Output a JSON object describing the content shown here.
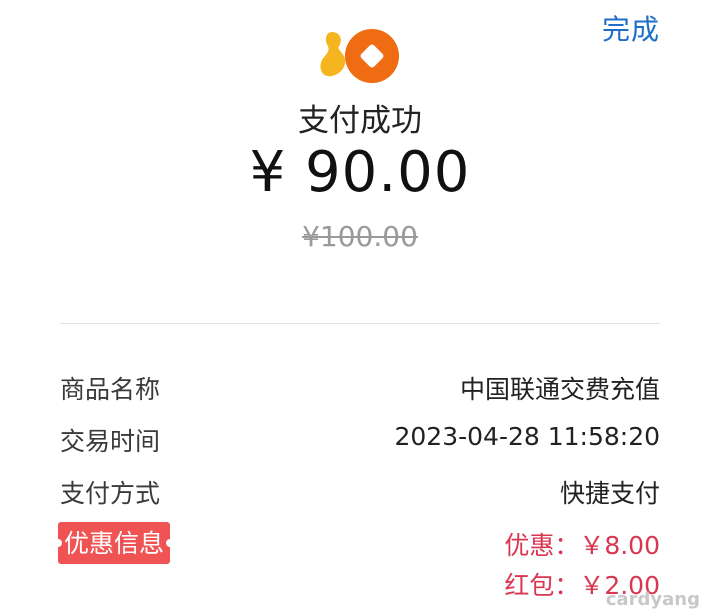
{
  "header": {
    "done_label": "完成"
  },
  "logo": {
    "icon": "pay-logo-icon",
    "colors": {
      "yellow": "#f5b51f",
      "orange": "#f06c12"
    }
  },
  "payment": {
    "status": "支付成功",
    "amount": "¥ 90.00",
    "original_amount": "¥100.00"
  },
  "details": [
    {
      "label": "商品名称",
      "value": "中国联通交费充值"
    },
    {
      "label": "交易时间",
      "value": "2023-04-28 11:58:20"
    },
    {
      "label": "支付方式",
      "value": "快捷支付"
    }
  ],
  "discount": {
    "label": "优惠信息",
    "coupon": "优惠：￥8.00",
    "red_packet": "红包：￥2.00",
    "accent": "#d93650",
    "tag_bg": "#f05353"
  },
  "watermark": "cardyang"
}
